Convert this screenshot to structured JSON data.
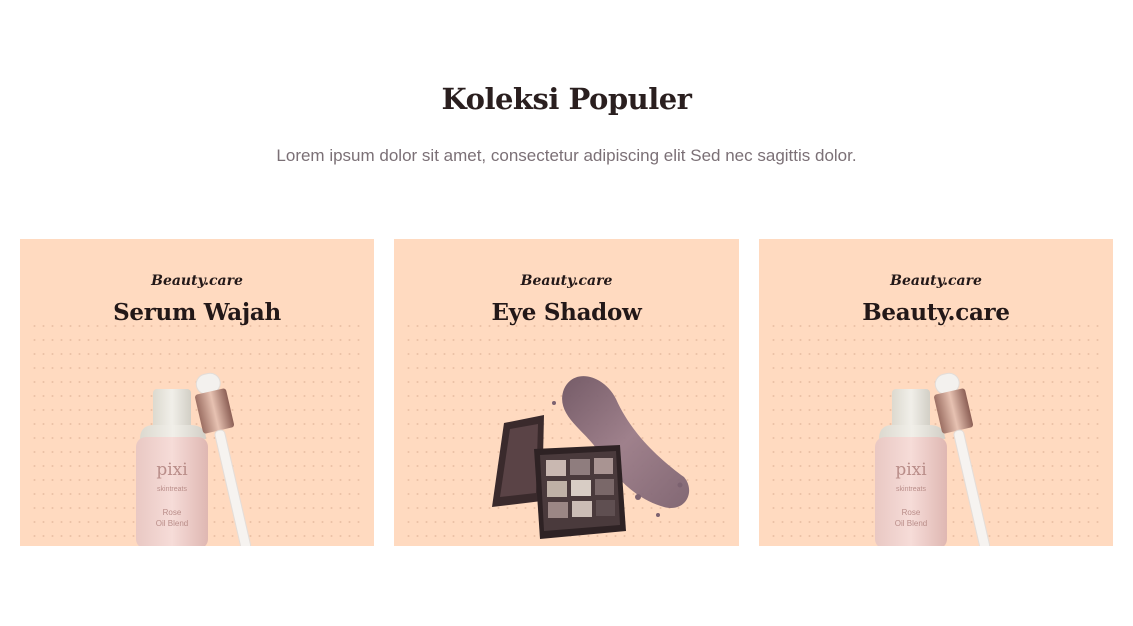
{
  "section": {
    "title": "Koleksi Populer",
    "subtitle": "Lorem ipsum dolor sit amet, consectetur adipiscing elit Sed nec sagittis dolor."
  },
  "cards": [
    {
      "brand": "Beauty.care",
      "title": "Serum Wajah",
      "image_icon": "serum-bottle-icon",
      "bottle_label": [
        "pixi",
        "skintreats",
        "Rose",
        "Oil Blend"
      ]
    },
    {
      "brand": "Beauty.care",
      "title": "Eye Shadow",
      "image_icon": "eyeshadow-palette-icon"
    },
    {
      "brand": "Beauty.care",
      "title": "Beauty.care",
      "image_icon": "serum-bottle-icon",
      "bottle_label": [
        "pixi",
        "skintreats",
        "Rose",
        "Oil Blend"
      ]
    }
  ],
  "colors": {
    "card_background": "#ffdac0",
    "heading": "#2a1f1f",
    "subtitle": "#7b7076"
  }
}
